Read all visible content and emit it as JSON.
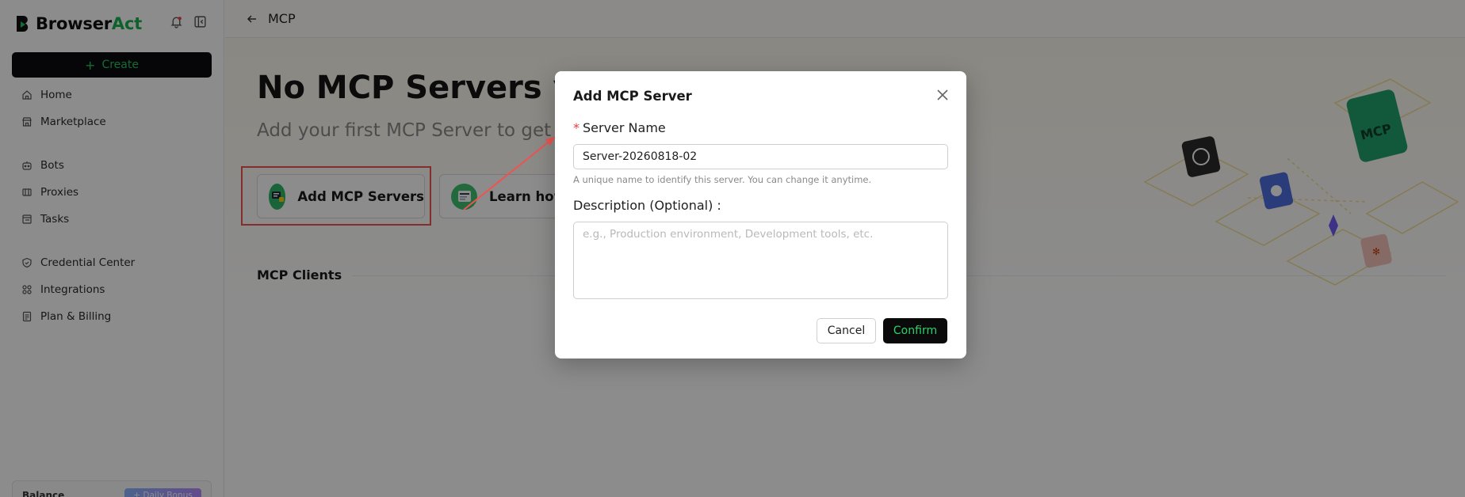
{
  "sidebar": {
    "brand": {
      "prefix": "Browser",
      "accent": "Act"
    },
    "create_label": "Create",
    "items": [
      {
        "label": "Home",
        "icon": "home-icon"
      },
      {
        "label": "Marketplace",
        "icon": "marketplace-icon"
      },
      {
        "label": "Bots",
        "icon": "bot-icon"
      },
      {
        "label": "Proxies",
        "icon": "proxy-icon"
      },
      {
        "label": "Tasks",
        "icon": "tasks-icon"
      },
      {
        "label": "Credential Center",
        "icon": "shield-icon"
      },
      {
        "label": "Integrations",
        "icon": "integrations-icon"
      },
      {
        "label": "Plan & Billing",
        "icon": "billing-icon"
      }
    ],
    "balance_label": "Balance",
    "balance_badge": "+ Daily Bonus"
  },
  "header": {
    "title": "MCP"
  },
  "main": {
    "hero_title": "No MCP Servers yet",
    "hero_subtitle": "Add your first MCP Server to get started",
    "cards": [
      {
        "label": "Add MCP Servers",
        "icon": "mcp-server-icon"
      },
      {
        "label": "Learn how",
        "icon": "blog-icon"
      }
    ],
    "clients_label": "MCP Clients",
    "illustration_label": "MCP"
  },
  "modal": {
    "title": "Add MCP Server",
    "server_name_label": "Server Name",
    "server_name_value": "Server-20260818-02",
    "server_name_helper": "A unique name to identify this server. You can change it anytime.",
    "description_label": "Description (Optional) :",
    "description_placeholder": "e.g., Production environment, Development tools, etc.",
    "cancel_label": "Cancel",
    "confirm_label": "Confirm"
  },
  "colors": {
    "accent": "#22c55e",
    "highlight": "#ef5350",
    "dark": "#0b0b12"
  }
}
